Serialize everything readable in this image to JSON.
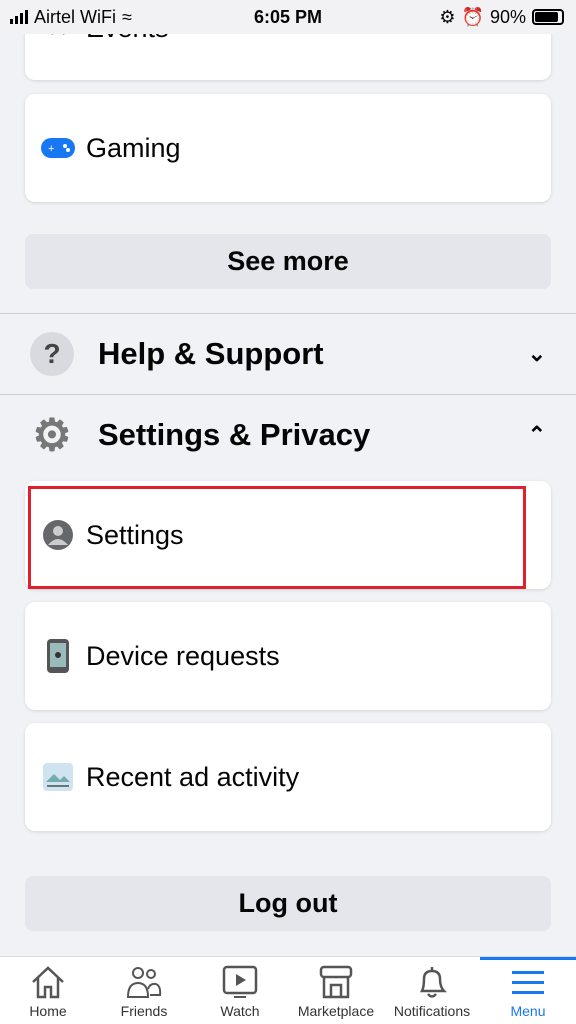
{
  "status_bar": {
    "carrier": "Airtel WiFi",
    "time": "6:05 PM",
    "battery": "90%",
    "battery_level": 0.9
  },
  "menu": {
    "events_label": "Events",
    "gaming_label": "Gaming",
    "see_more": "See more",
    "help": {
      "label": "Help & Support",
      "expanded": false
    },
    "settings_privacy": {
      "label": "Settings & Privacy",
      "expanded": true
    },
    "sub_items": [
      {
        "label": "Settings",
        "icon": "user-circle-icon",
        "highlighted": true
      },
      {
        "label": "Device requests",
        "icon": "phone-key-icon"
      },
      {
        "label": "Recent ad activity",
        "icon": "ad-image-icon"
      }
    ],
    "logout": "Log out"
  },
  "highlight_color": "#e0202c",
  "accent": "#1877f2",
  "bottom_nav": [
    {
      "label": "Home"
    },
    {
      "label": "Friends"
    },
    {
      "label": "Watch"
    },
    {
      "label": "Marketplace"
    },
    {
      "label": "Notifications"
    },
    {
      "label": "Menu",
      "active": true
    }
  ]
}
